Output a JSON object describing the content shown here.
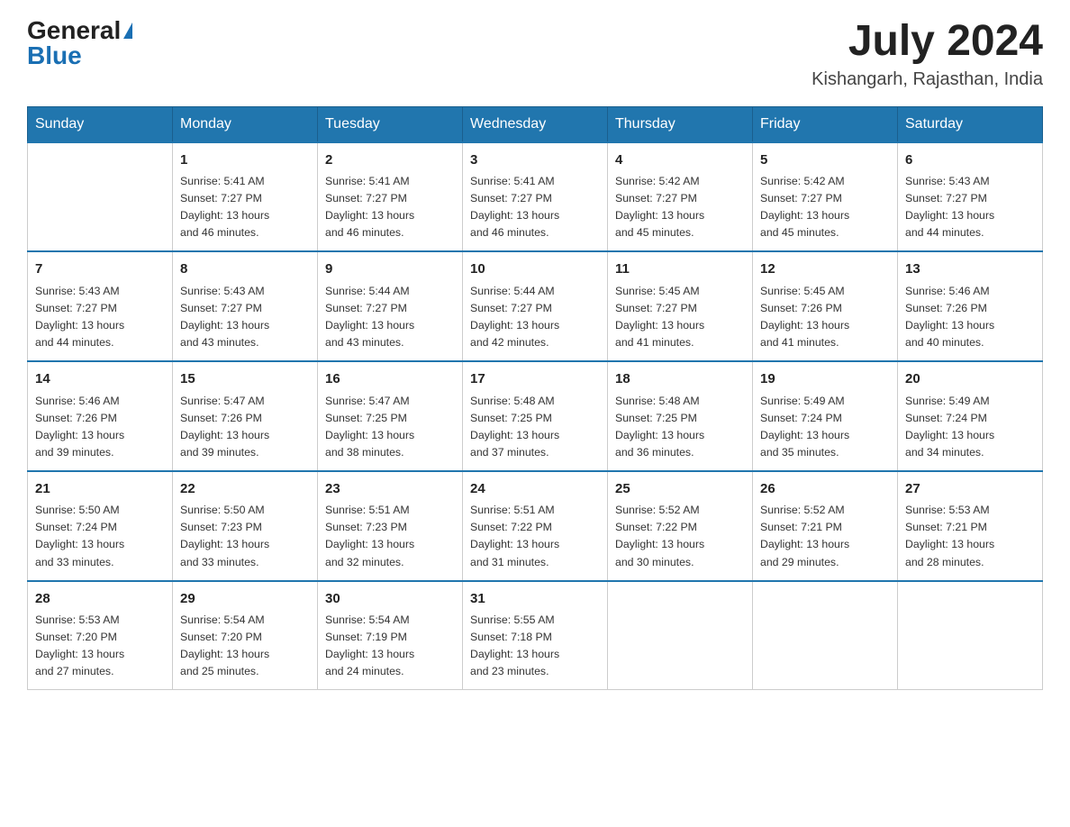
{
  "header": {
    "logo_general": "General",
    "logo_blue": "Blue",
    "month_year": "July 2024",
    "location": "Kishangarh, Rajasthan, India"
  },
  "days_of_week": [
    "Sunday",
    "Monday",
    "Tuesday",
    "Wednesday",
    "Thursday",
    "Friday",
    "Saturday"
  ],
  "weeks": [
    [
      {
        "day": "",
        "info": ""
      },
      {
        "day": "1",
        "info": "Sunrise: 5:41 AM\nSunset: 7:27 PM\nDaylight: 13 hours\nand 46 minutes."
      },
      {
        "day": "2",
        "info": "Sunrise: 5:41 AM\nSunset: 7:27 PM\nDaylight: 13 hours\nand 46 minutes."
      },
      {
        "day": "3",
        "info": "Sunrise: 5:41 AM\nSunset: 7:27 PM\nDaylight: 13 hours\nand 46 minutes."
      },
      {
        "day": "4",
        "info": "Sunrise: 5:42 AM\nSunset: 7:27 PM\nDaylight: 13 hours\nand 45 minutes."
      },
      {
        "day": "5",
        "info": "Sunrise: 5:42 AM\nSunset: 7:27 PM\nDaylight: 13 hours\nand 45 minutes."
      },
      {
        "day": "6",
        "info": "Sunrise: 5:43 AM\nSunset: 7:27 PM\nDaylight: 13 hours\nand 44 minutes."
      }
    ],
    [
      {
        "day": "7",
        "info": "Sunrise: 5:43 AM\nSunset: 7:27 PM\nDaylight: 13 hours\nand 44 minutes."
      },
      {
        "day": "8",
        "info": "Sunrise: 5:43 AM\nSunset: 7:27 PM\nDaylight: 13 hours\nand 43 minutes."
      },
      {
        "day": "9",
        "info": "Sunrise: 5:44 AM\nSunset: 7:27 PM\nDaylight: 13 hours\nand 43 minutes."
      },
      {
        "day": "10",
        "info": "Sunrise: 5:44 AM\nSunset: 7:27 PM\nDaylight: 13 hours\nand 42 minutes."
      },
      {
        "day": "11",
        "info": "Sunrise: 5:45 AM\nSunset: 7:27 PM\nDaylight: 13 hours\nand 41 minutes."
      },
      {
        "day": "12",
        "info": "Sunrise: 5:45 AM\nSunset: 7:26 PM\nDaylight: 13 hours\nand 41 minutes."
      },
      {
        "day": "13",
        "info": "Sunrise: 5:46 AM\nSunset: 7:26 PM\nDaylight: 13 hours\nand 40 minutes."
      }
    ],
    [
      {
        "day": "14",
        "info": "Sunrise: 5:46 AM\nSunset: 7:26 PM\nDaylight: 13 hours\nand 39 minutes."
      },
      {
        "day": "15",
        "info": "Sunrise: 5:47 AM\nSunset: 7:26 PM\nDaylight: 13 hours\nand 39 minutes."
      },
      {
        "day": "16",
        "info": "Sunrise: 5:47 AM\nSunset: 7:25 PM\nDaylight: 13 hours\nand 38 minutes."
      },
      {
        "day": "17",
        "info": "Sunrise: 5:48 AM\nSunset: 7:25 PM\nDaylight: 13 hours\nand 37 minutes."
      },
      {
        "day": "18",
        "info": "Sunrise: 5:48 AM\nSunset: 7:25 PM\nDaylight: 13 hours\nand 36 minutes."
      },
      {
        "day": "19",
        "info": "Sunrise: 5:49 AM\nSunset: 7:24 PM\nDaylight: 13 hours\nand 35 minutes."
      },
      {
        "day": "20",
        "info": "Sunrise: 5:49 AM\nSunset: 7:24 PM\nDaylight: 13 hours\nand 34 minutes."
      }
    ],
    [
      {
        "day": "21",
        "info": "Sunrise: 5:50 AM\nSunset: 7:24 PM\nDaylight: 13 hours\nand 33 minutes."
      },
      {
        "day": "22",
        "info": "Sunrise: 5:50 AM\nSunset: 7:23 PM\nDaylight: 13 hours\nand 33 minutes."
      },
      {
        "day": "23",
        "info": "Sunrise: 5:51 AM\nSunset: 7:23 PM\nDaylight: 13 hours\nand 32 minutes."
      },
      {
        "day": "24",
        "info": "Sunrise: 5:51 AM\nSunset: 7:22 PM\nDaylight: 13 hours\nand 31 minutes."
      },
      {
        "day": "25",
        "info": "Sunrise: 5:52 AM\nSunset: 7:22 PM\nDaylight: 13 hours\nand 30 minutes."
      },
      {
        "day": "26",
        "info": "Sunrise: 5:52 AM\nSunset: 7:21 PM\nDaylight: 13 hours\nand 29 minutes."
      },
      {
        "day": "27",
        "info": "Sunrise: 5:53 AM\nSunset: 7:21 PM\nDaylight: 13 hours\nand 28 minutes."
      }
    ],
    [
      {
        "day": "28",
        "info": "Sunrise: 5:53 AM\nSunset: 7:20 PM\nDaylight: 13 hours\nand 27 minutes."
      },
      {
        "day": "29",
        "info": "Sunrise: 5:54 AM\nSunset: 7:20 PM\nDaylight: 13 hours\nand 25 minutes."
      },
      {
        "day": "30",
        "info": "Sunrise: 5:54 AM\nSunset: 7:19 PM\nDaylight: 13 hours\nand 24 minutes."
      },
      {
        "day": "31",
        "info": "Sunrise: 5:55 AM\nSunset: 7:18 PM\nDaylight: 13 hours\nand 23 minutes."
      },
      {
        "day": "",
        "info": ""
      },
      {
        "day": "",
        "info": ""
      },
      {
        "day": "",
        "info": ""
      }
    ]
  ]
}
